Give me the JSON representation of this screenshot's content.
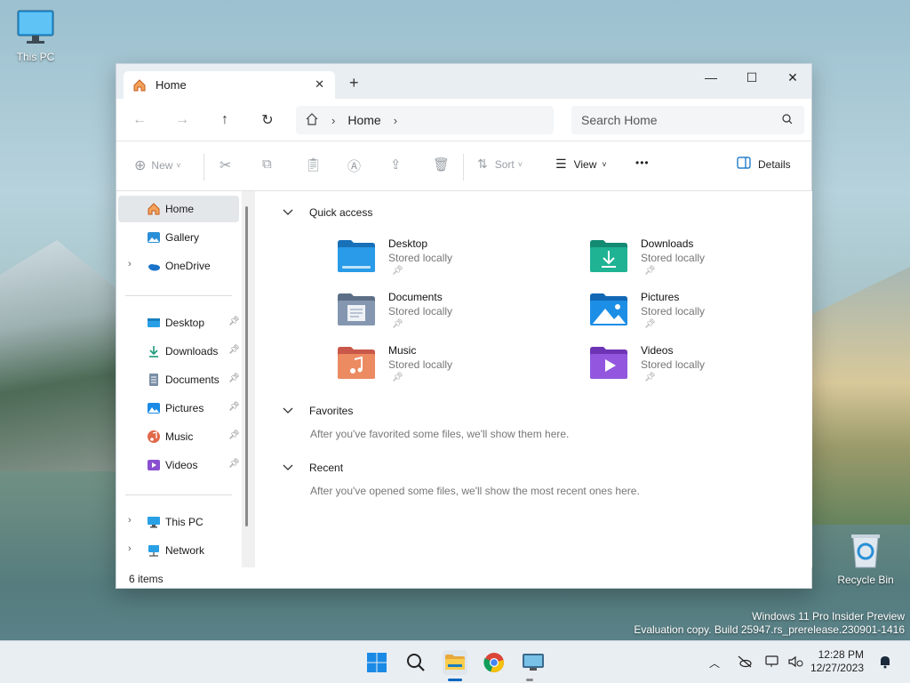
{
  "desktop": {
    "icons": [
      {
        "label": "This PC",
        "icon": "monitor-icon"
      },
      {
        "label": "Recycle Bin",
        "icon": "recycle-bin-icon"
      }
    ],
    "watermark_line1": "Windows 11 Pro Insider Preview",
    "watermark_line2": "Evaluation copy. Build 25947.rs_prerelease.230901-1416"
  },
  "window": {
    "tab_title": "Home",
    "new_tab": "+",
    "controls": {
      "minimize": "—",
      "maximize": "☐",
      "close": "✕"
    },
    "address": {
      "breadcrumb": "Home"
    },
    "search_placeholder": "Search Home",
    "commands": {
      "new_label": "New",
      "sort_label": "Sort",
      "view_label": "View",
      "more_label": "•••",
      "details_label": "Details"
    },
    "nav": {
      "top": [
        {
          "label": "Home",
          "icon": "home-icon",
          "selected": true
        },
        {
          "label": "Gallery",
          "icon": "gallery-icon"
        },
        {
          "label": "OneDrive",
          "icon": "onedrive-icon",
          "expandable": true
        }
      ],
      "pinned": [
        {
          "label": "Desktop",
          "icon": "desktop-folder-icon"
        },
        {
          "label": "Downloads",
          "icon": "downloads-icon"
        },
        {
          "label": "Documents",
          "icon": "documents-icon"
        },
        {
          "label": "Pictures",
          "icon": "pictures-icon"
        },
        {
          "label": "Music",
          "icon": "music-icon"
        },
        {
          "label": "Videos",
          "icon": "videos-icon"
        }
      ],
      "bottom": [
        {
          "label": "This PC",
          "icon": "this-pc-icon"
        },
        {
          "label": "Network",
          "icon": "network-icon"
        }
      ]
    },
    "content": {
      "quick_access_title": "Quick access",
      "quick_access": [
        {
          "name": "Desktop",
          "sub": "Stored locally",
          "color": "#1f8ad8"
        },
        {
          "name": "Downloads",
          "sub": "Stored locally",
          "color": "#1aa38a"
        },
        {
          "name": "Documents",
          "sub": "Stored locally",
          "color": "#7d8fa8"
        },
        {
          "name": "Pictures",
          "sub": "Stored locally",
          "color": "#1a8ae6"
        },
        {
          "name": "Music",
          "sub": "Stored locally",
          "color": "#e07a5a"
        },
        {
          "name": "Videos",
          "sub": "Stored locally",
          "color": "#8a4fd0"
        }
      ],
      "favorites_title": "Favorites",
      "favorites_hint": "After you've favorited some files, we'll show them here.",
      "recent_title": "Recent",
      "recent_hint": "After you've opened some files, we'll show the most recent ones here."
    },
    "status": "6 items"
  },
  "taskbar": {
    "time": "12:28 PM",
    "date": "12/27/2023"
  }
}
